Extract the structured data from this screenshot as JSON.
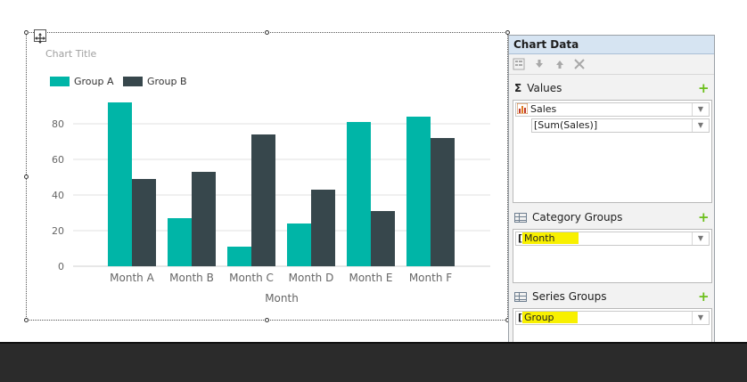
{
  "chart_data": {
    "type": "bar",
    "title": "Chart Title",
    "categories": [
      "Month A",
      "Month B",
      "Month C",
      "Month D",
      "Month E",
      "Month F"
    ],
    "series": [
      {
        "name": "Group A",
        "values": [
          92,
          27,
          11,
          24,
          81,
          84
        ],
        "color": "#00b5a7"
      },
      {
        "name": "Group B",
        "values": [
          49,
          53,
          74,
          43,
          31,
          72
        ],
        "color": "#37474c"
      }
    ],
    "xlabel": "Month",
    "ylabel": "",
    "yticks": [
      0,
      20,
      40,
      60,
      80
    ],
    "ylim": [
      0,
      100
    ],
    "grid": true,
    "legend": "top-left"
  },
  "panel": {
    "title": "Chart Data",
    "values": {
      "title": "Values",
      "field_name": "Sales",
      "expression": "[Sum(Sales)]"
    },
    "category_groups": {
      "title": "Category Groups",
      "field": "Month"
    },
    "series_groups": {
      "title": "Series Groups",
      "field": "Group"
    }
  },
  "icons": {
    "move": "move-icon",
    "sigma": "sigma-icon",
    "add": "plus-icon",
    "grid": "grid-icon"
  },
  "colors": {
    "panel_header": "#d6e4f2",
    "highlight": "#f8f000",
    "accent_green": "#6bbf1a"
  }
}
